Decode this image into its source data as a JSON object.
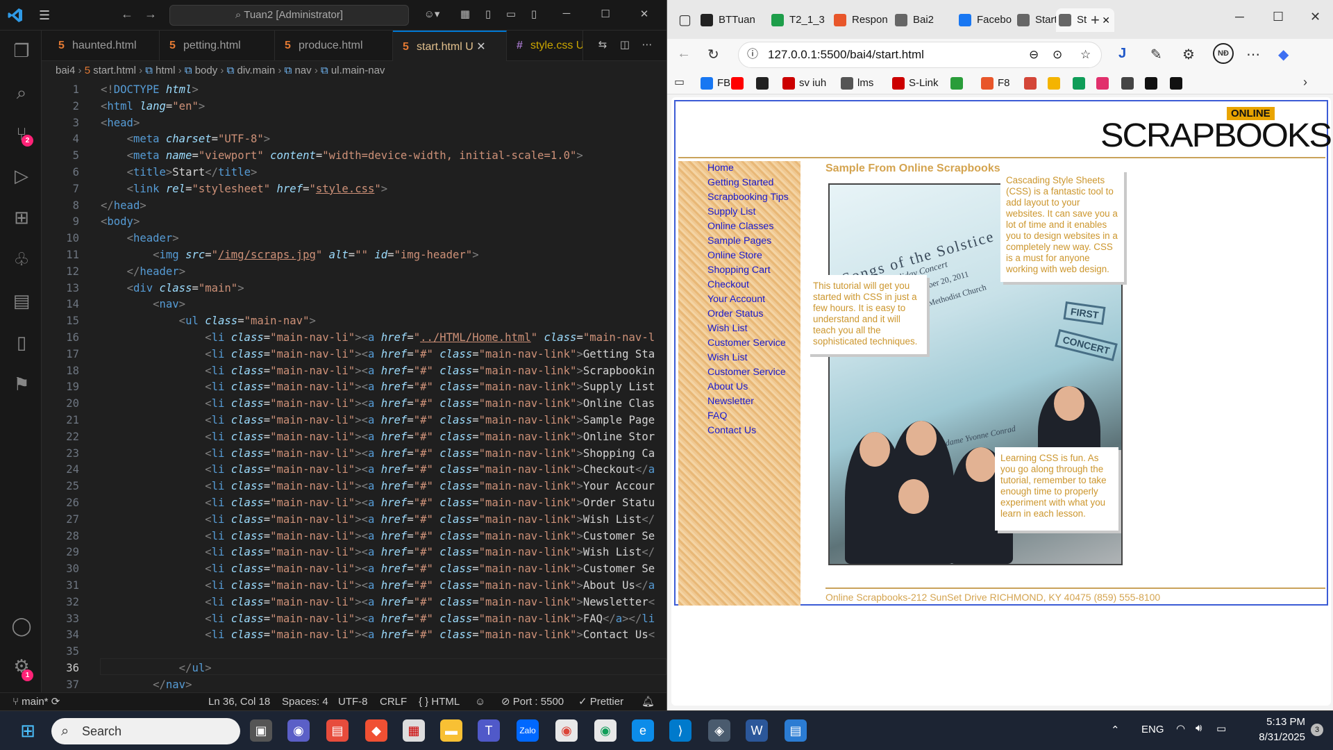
{
  "vscode": {
    "command_center": "Tuan2 [Administrator]",
    "tabs": [
      {
        "label": "haunted.html"
      },
      {
        "label": "petting.html"
      },
      {
        "label": "produce.html"
      },
      {
        "label": "start.html",
        "mark": "U"
      },
      {
        "label": "style.css",
        "mark": "U"
      }
    ],
    "breadcrumb": [
      "bai4",
      "start.html",
      "html",
      "body",
      "div.main",
      "nav",
      "ul.main-nav"
    ],
    "activity_badges": {
      "scm": "2",
      "settings": "1"
    },
    "code_lines": [
      {
        "n": "1",
        "html": "<span class='pn'>&lt;!</span><span class='tg'>DOCTYPE</span> <span class='at'>html</span><span class='pn'>&gt;</span>"
      },
      {
        "n": "2",
        "html": "<span class='pn'>&lt;</span><span class='tg'>html</span> <span class='at'>lang</span>=<span class='st'>\"en\"</span><span class='pn'>&gt;</span>"
      },
      {
        "n": "3",
        "html": "<span class='pn'>&lt;</span><span class='tg'>head</span><span class='pn'>&gt;</span>"
      },
      {
        "n": "4",
        "html": "    <span class='pn'>&lt;</span><span class='tg'>meta</span> <span class='at'>charset</span>=<span class='st'>\"UTF-8\"</span><span class='pn'>&gt;</span>"
      },
      {
        "n": "5",
        "html": "    <span class='pn'>&lt;</span><span class='tg'>meta</span> <span class='at'>name</span>=<span class='st'>\"viewport\"</span> <span class='at'>content</span>=<span class='st'>\"width=device-width, initial-scale=1.0\"</span><span class='pn'>&gt;</span>"
      },
      {
        "n": "6",
        "html": "    <span class='pn'>&lt;</span><span class='tg'>title</span><span class='pn'>&gt;</span>Start<span class='pn'>&lt;/</span><span class='tg'>title</span><span class='pn'>&gt;</span>"
      },
      {
        "n": "7",
        "html": "    <span class='pn'>&lt;</span><span class='tg'>link</span> <span class='at'>rel</span>=<span class='st'>\"stylesheet\"</span> <span class='at'>href</span>=<span class='st'>\"<span class='link'>style.css</span>\"</span><span class='pn'>&gt;</span>"
      },
      {
        "n": "8",
        "html": "<span class='pn'>&lt;/</span><span class='tg'>head</span><span class='pn'>&gt;</span>"
      },
      {
        "n": "9",
        "html": "<span class='pn'>&lt;</span><span class='tg'>body</span><span class='pn'>&gt;</span>"
      },
      {
        "n": "10",
        "html": "    <span class='pn'>&lt;</span><span class='tg'>header</span><span class='pn'>&gt;</span>"
      },
      {
        "n": "11",
        "html": "        <span class='pn'>&lt;</span><span class='tg'>img</span> <span class='at'>src</span>=<span class='st'>\"<span class='link'>/img/scraps.jpg</span>\"</span> <span class='at'>alt</span>=<span class='st'>\"\"</span> <span class='at'>id</span>=<span class='st'>\"img-header\"</span><span class='pn'>&gt;</span>"
      },
      {
        "n": "12",
        "html": "    <span class='pn'>&lt;/</span><span class='tg'>header</span><span class='pn'>&gt;</span>"
      },
      {
        "n": "13",
        "html": "    <span class='pn'>&lt;</span><span class='tg'>div</span> <span class='at'>class</span>=<span class='st'>\"main\"</span><span class='pn'>&gt;</span>"
      },
      {
        "n": "14",
        "html": "        <span class='pn'>&lt;</span><span class='tg'>nav</span><span class='pn'>&gt;</span>"
      },
      {
        "n": "15",
        "html": "            <span class='pn'>&lt;</span><span class='tg'>ul</span> <span class='at'>class</span>=<span class='st'>\"main-nav\"</span><span class='pn'>&gt;</span>"
      },
      {
        "n": "16",
        "html": "                <span class='pn'>&lt;</span><span class='tg'>li</span> <span class='at'>class</span>=<span class='st'>\"main-nav-li\"</span><span class='pn'>&gt;&lt;</span><span class='tg'>a</span> <span class='at'>href</span>=<span class='st'>\"<span class='link'>../HTML/Home.html</span>\"</span> <span class='at'>class</span>=<span class='st'>\"main-nav-l</span>"
      },
      {
        "n": "17",
        "html": "                <span class='pn'>&lt;</span><span class='tg'>li</span> <span class='at'>class</span>=<span class='st'>\"main-nav-li\"</span><span class='pn'>&gt;&lt;</span><span class='tg'>a</span> <span class='at'>href</span>=<span class='st'>\"#\"</span> <span class='at'>class</span>=<span class='st'>\"main-nav-link\"</span><span class='pn'>&gt;</span>Getting Sta"
      },
      {
        "n": "18",
        "html": "                <span class='pn'>&lt;</span><span class='tg'>li</span> <span class='at'>class</span>=<span class='st'>\"main-nav-li\"</span><span class='pn'>&gt;&lt;</span><span class='tg'>a</span> <span class='at'>href</span>=<span class='st'>\"#\"</span> <span class='at'>class</span>=<span class='st'>\"main-nav-link\"</span><span class='pn'>&gt;</span>Scrapbookin"
      },
      {
        "n": "19",
        "html": "                <span class='pn'>&lt;</span><span class='tg'>li</span> <span class='at'>class</span>=<span class='st'>\"main-nav-li\"</span><span class='pn'>&gt;&lt;</span><span class='tg'>a</span> <span class='at'>href</span>=<span class='st'>\"#\"</span> <span class='at'>class</span>=<span class='st'>\"main-nav-link\"</span><span class='pn'>&gt;</span>Supply List"
      },
      {
        "n": "20",
        "html": "                <span class='pn'>&lt;</span><span class='tg'>li</span> <span class='at'>class</span>=<span class='st'>\"main-nav-li\"</span><span class='pn'>&gt;&lt;</span><span class='tg'>a</span> <span class='at'>href</span>=<span class='st'>\"#\"</span> <span class='at'>class</span>=<span class='st'>\"main-nav-link\"</span><span class='pn'>&gt;</span>Online Clas"
      },
      {
        "n": "21",
        "html": "                <span class='pn'>&lt;</span><span class='tg'>li</span> <span class='at'>class</span>=<span class='st'>\"main-nav-li\"</span><span class='pn'>&gt;&lt;</span><span class='tg'>a</span> <span class='at'>href</span>=<span class='st'>\"#\"</span> <span class='at'>class</span>=<span class='st'>\"main-nav-link\"</span><span class='pn'>&gt;</span>Sample Page"
      },
      {
        "n": "22",
        "html": "                <span class='pn'>&lt;</span><span class='tg'>li</span> <span class='at'>class</span>=<span class='st'>\"main-nav-li\"</span><span class='pn'>&gt;&lt;</span><span class='tg'>a</span> <span class='at'>href</span>=<span class='st'>\"#\"</span> <span class='at'>class</span>=<span class='st'>\"main-nav-link\"</span><span class='pn'>&gt;</span>Online Stor"
      },
      {
        "n": "23",
        "html": "                <span class='pn'>&lt;</span><span class='tg'>li</span> <span class='at'>class</span>=<span class='st'>\"main-nav-li\"</span><span class='pn'>&gt;&lt;</span><span class='tg'>a</span> <span class='at'>href</span>=<span class='st'>\"#\"</span> <span class='at'>class</span>=<span class='st'>\"main-nav-link\"</span><span class='pn'>&gt;</span>Shopping Ca"
      },
      {
        "n": "24",
        "html": "                <span class='pn'>&lt;</span><span class='tg'>li</span> <span class='at'>class</span>=<span class='st'>\"main-nav-li\"</span><span class='pn'>&gt;&lt;</span><span class='tg'>a</span> <span class='at'>href</span>=<span class='st'>\"#\"</span> <span class='at'>class</span>=<span class='st'>\"main-nav-link\"</span><span class='pn'>&gt;</span>Checkout<span class='pn'>&lt;/</span><span class='tg'>a</span>"
      },
      {
        "n": "25",
        "html": "                <span class='pn'>&lt;</span><span class='tg'>li</span> <span class='at'>class</span>=<span class='st'>\"main-nav-li\"</span><span class='pn'>&gt;&lt;</span><span class='tg'>a</span> <span class='at'>href</span>=<span class='st'>\"#\"</span> <span class='at'>class</span>=<span class='st'>\"main-nav-link\"</span><span class='pn'>&gt;</span>Your Accour"
      },
      {
        "n": "26",
        "html": "                <span class='pn'>&lt;</span><span class='tg'>li</span> <span class='at'>class</span>=<span class='st'>\"main-nav-li\"</span><span class='pn'>&gt;&lt;</span><span class='tg'>a</span> <span class='at'>href</span>=<span class='st'>\"#\"</span> <span class='at'>class</span>=<span class='st'>\"main-nav-link\"</span><span class='pn'>&gt;</span>Order Statu"
      },
      {
        "n": "27",
        "html": "                <span class='pn'>&lt;</span><span class='tg'>li</span> <span class='at'>class</span>=<span class='st'>\"main-nav-li\"</span><span class='pn'>&gt;&lt;</span><span class='tg'>a</span> <span class='at'>href</span>=<span class='st'>\"#\"</span> <span class='at'>class</span>=<span class='st'>\"main-nav-link\"</span><span class='pn'>&gt;</span>Wish List<span class='pn'>&lt;/</span>"
      },
      {
        "n": "28",
        "html": "                <span class='pn'>&lt;</span><span class='tg'>li</span> <span class='at'>class</span>=<span class='st'>\"main-nav-li\"</span><span class='pn'>&gt;&lt;</span><span class='tg'>a</span> <span class='at'>href</span>=<span class='st'>\"#\"</span> <span class='at'>class</span>=<span class='st'>\"main-nav-link\"</span><span class='pn'>&gt;</span>Customer Se"
      },
      {
        "n": "29",
        "html": "                <span class='pn'>&lt;</span><span class='tg'>li</span> <span class='at'>class</span>=<span class='st'>\"main-nav-li\"</span><span class='pn'>&gt;&lt;</span><span class='tg'>a</span> <span class='at'>href</span>=<span class='st'>\"#\"</span> <span class='at'>class</span>=<span class='st'>\"main-nav-link\"</span><span class='pn'>&gt;</span>Wish List<span class='pn'>&lt;/</span>"
      },
      {
        "n": "30",
        "html": "                <span class='pn'>&lt;</span><span class='tg'>li</span> <span class='at'>class</span>=<span class='st'>\"main-nav-li\"</span><span class='pn'>&gt;&lt;</span><span class='tg'>a</span> <span class='at'>href</span>=<span class='st'>\"#\"</span> <span class='at'>class</span>=<span class='st'>\"main-nav-link\"</span><span class='pn'>&gt;</span>Customer Se"
      },
      {
        "n": "31",
        "html": "                <span class='pn'>&lt;</span><span class='tg'>li</span> <span class='at'>class</span>=<span class='st'>\"main-nav-li\"</span><span class='pn'>&gt;&lt;</span><span class='tg'>a</span> <span class='at'>href</span>=<span class='st'>\"#\"</span> <span class='at'>class</span>=<span class='st'>\"main-nav-link\"</span><span class='pn'>&gt;</span>About Us<span class='pn'>&lt;/</span><span class='tg'>a</span>"
      },
      {
        "n": "32",
        "html": "                <span class='pn'>&lt;</span><span class='tg'>li</span> <span class='at'>class</span>=<span class='st'>\"main-nav-li\"</span><span class='pn'>&gt;&lt;</span><span class='tg'>a</span> <span class='at'>href</span>=<span class='st'>\"#\"</span> <span class='at'>class</span>=<span class='st'>\"main-nav-link\"</span><span class='pn'>&gt;</span>Newsletter<span class='pn'>&lt;</span>"
      },
      {
        "n": "33",
        "html": "                <span class='pn'>&lt;</span><span class='tg'>li</span> <span class='at'>class</span>=<span class='st'>\"main-nav-li\"</span><span class='pn'>&gt;&lt;</span><span class='tg'>a</span> <span class='at'>href</span>=<span class='st'>\"#\"</span> <span class='at'>class</span>=<span class='st'>\"main-nav-link\"</span><span class='pn'>&gt;</span>FAQ<span class='pn'>&lt;/</span><span class='tg'>a</span><span class='pn'>&gt;&lt;/</span><span class='tg'>li</span>"
      },
      {
        "n": "34",
        "html": "                <span class='pn'>&lt;</span><span class='tg'>li</span> <span class='at'>class</span>=<span class='st'>\"main-nav-li\"</span><span class='pn'>&gt;&lt;</span><span class='tg'>a</span> <span class='at'>href</span>=<span class='st'>\"#\"</span> <span class='at'>class</span>=<span class='st'>\"main-nav-link\"</span><span class='pn'>&gt;</span>Contact Us<span class='pn'>&lt;</span>"
      },
      {
        "n": "35",
        "html": ""
      },
      {
        "n": "36",
        "html": "            <span class='pn'>&lt;/</span><span class='tg'>ul</span><span class='pn'>&gt;</span>"
      },
      {
        "n": "37",
        "html": "        <span class='pn'>&lt;/</span><span class='tg'>nav</span><span class='pn'>&gt;</span>"
      }
    ],
    "status": {
      "branch": "main*",
      "position": "Ln 36, Col 18",
      "spaces": "Spaces: 4",
      "encoding": "UTF-8",
      "eol": "CRLF",
      "language": "HTML",
      "port": "Port : 5500",
      "prettier": "Prettier"
    }
  },
  "edge": {
    "tabs": [
      {
        "label": "BTTuan",
        "color": "#222"
      },
      {
        "label": "T2_1_3",
        "color": "#1e9e4a"
      },
      {
        "label": "Respon",
        "color": "#e8562a"
      },
      {
        "label": "Bai2",
        "color": "#666"
      },
      {
        "label": "Facebo",
        "color": "#1877f2"
      },
      {
        "label": "Start",
        "color": "#666"
      },
      {
        "label": "St",
        "color": "#666"
      }
    ],
    "url": "127.0.0.1:5500/bai4/start.html",
    "profile": "NĐ",
    "favorites": [
      {
        "label": "FB",
        "color": "#1877f2"
      },
      {
        "label": "",
        "color": "#ff0000"
      },
      {
        "label": "",
        "color": "#222"
      },
      {
        "label": "sv iuh",
        "color": "#c00"
      },
      {
        "label": "lms",
        "color": "#555"
      },
      {
        "label": "S-Link",
        "color": "#c00"
      },
      {
        "label": "",
        "color": "#2a9d3a"
      },
      {
        "label": "F8",
        "color": "#e8562a"
      },
      {
        "label": "",
        "color": "#d44638"
      },
      {
        "label": "",
        "color": "#f4b400"
      },
      {
        "label": "",
        "color": "#0f9d58"
      },
      {
        "label": "",
        "color": "#e1306c"
      },
      {
        "label": "",
        "color": "#444"
      },
      {
        "label": "",
        "color": "#111"
      },
      {
        "label": "",
        "color": "#111"
      }
    ]
  },
  "site": {
    "logo_online": "ONLINE",
    "logo_text": "SCRAPBOOKS",
    "nav": [
      "Home",
      "Getting Started",
      "Scrapbooking Tips",
      "Supply List",
      "Online Classes",
      "Sample Pages",
      "Online Store",
      "Shopping Cart",
      "Checkout",
      "Your Account",
      "Order Status",
      "Wish List",
      "Customer Service",
      "Wish List",
      "Customer Service",
      "About Us",
      "Newsletter",
      "FAQ",
      "Contact Us"
    ],
    "main_heading": "Sample From Online Scrapbooks",
    "photo_texts": {
      "title": "Songs of the Solstice",
      "sub": "Holiday Concert",
      "date": "December 20, 2011",
      "church": "Methodist Church",
      "signature": "Madame Yvonne Conrad",
      "stamp1": "FIRST",
      "stamp2": "CONCERT"
    },
    "note1": "Cascading Style Sheets (CSS) is a fantastic tool to add layout to your websites. It can save you a lot of time and it enables you to design websites in a completely new way. CSS is a must for anyone working with web design.",
    "note2": "This tutorial will get you started with CSS in just a few hours. It is easy to understand and it will teach you all the sophisticated techniques.",
    "note3": "Learning CSS is fun. As you go along through the tutorial, remember to take enough time to properly experiment with what you learn in each lesson.",
    "footer": "Online Scrapbooks-212 SunSet Drive RICHMOND, KY 40475 (859) 555-8100"
  },
  "taskbar": {
    "search": "Search",
    "lang": "ENG",
    "time": "5:13 PM",
    "date": "8/31/2025",
    "notif": "3"
  }
}
